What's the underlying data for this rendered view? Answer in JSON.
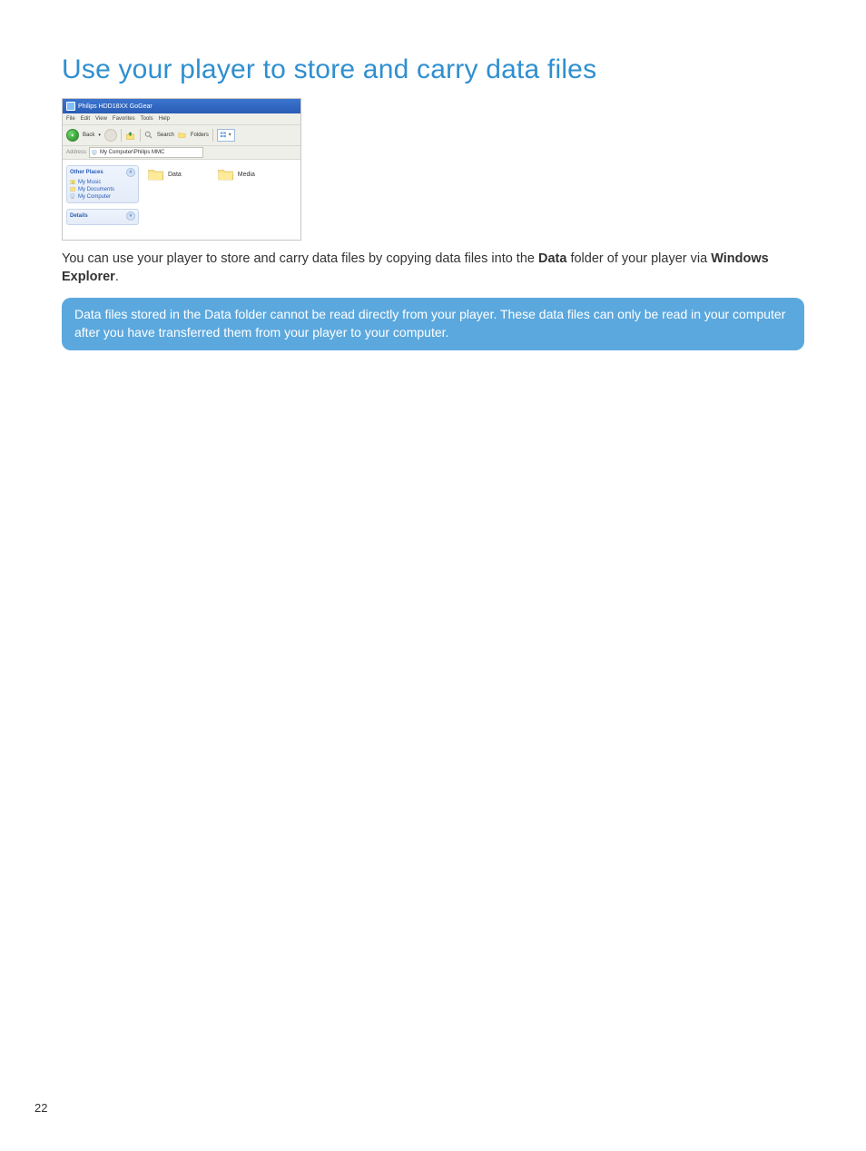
{
  "heading": "Use your player to store and carry data files",
  "screenshot": {
    "window_title": "Philips HDD18XX GoGear",
    "menu": [
      "File",
      "Edit",
      "View",
      "Favorites",
      "Tools",
      "Help"
    ],
    "toolbar": {
      "back_label": "Back",
      "search_label": "Search",
      "folders_label": "Folders"
    },
    "address": {
      "label": "Address",
      "value": "My Computer\\Philips MMC"
    },
    "sidebar": {
      "other_places": {
        "title": "Other Places",
        "links": [
          "My Music",
          "My Documents",
          "My Computer"
        ]
      },
      "details": {
        "title": "Details"
      }
    },
    "folders": [
      "Data",
      "Media"
    ]
  },
  "body_text": {
    "before_data": "You can use your player to store and carry data files by copying data files into the ",
    "data_word": "Data",
    "mid": " folder of your player via ",
    "we_word": "Windows Explorer",
    "after": "."
  },
  "note": "Data files stored in the Data folder cannot be read directly from your player.  These data files can only be read in your computer after you have transferred them from your player to your computer.",
  "page_number": "22"
}
